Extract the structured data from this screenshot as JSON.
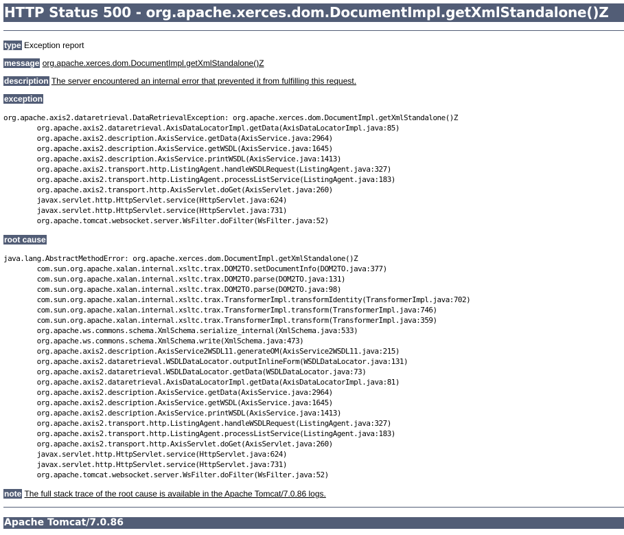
{
  "heading": "HTTP Status 500 - org.apache.xerces.dom.DocumentImpl.getXmlStandalone()Z",
  "type": {
    "label": "type",
    "value": "Exception report"
  },
  "message": {
    "label": "message",
    "value": "org.apache.xerces.dom.DocumentImpl.getXmlStandalone()Z"
  },
  "description": {
    "label": "description",
    "value": "The server encountered an internal error that prevented it from fulfilling this request."
  },
  "exception": {
    "label": "exception",
    "trace": "org.apache.axis2.dataretrieval.DataRetrievalException: org.apache.xerces.dom.DocumentImpl.getXmlStandalone()Z\n\torg.apache.axis2.dataretrieval.AxisDataLocatorImpl.getData(AxisDataLocatorImpl.java:85)\n\torg.apache.axis2.description.AxisService.getData(AxisService.java:2964)\n\torg.apache.axis2.description.AxisService.getWSDL(AxisService.java:1645)\n\torg.apache.axis2.description.AxisService.printWSDL(AxisService.java:1413)\n\torg.apache.axis2.transport.http.ListingAgent.handleWSDLRequest(ListingAgent.java:327)\n\torg.apache.axis2.transport.http.ListingAgent.processListService(ListingAgent.java:183)\n\torg.apache.axis2.transport.http.AxisServlet.doGet(AxisServlet.java:260)\n\tjavax.servlet.http.HttpServlet.service(HttpServlet.java:624)\n\tjavax.servlet.http.HttpServlet.service(HttpServlet.java:731)\n\torg.apache.tomcat.websocket.server.WsFilter.doFilter(WsFilter.java:52)"
  },
  "root_cause": {
    "label": "root cause",
    "trace": "java.lang.AbstractMethodError: org.apache.xerces.dom.DocumentImpl.getXmlStandalone()Z\n\tcom.sun.org.apache.xalan.internal.xsltc.trax.DOM2TO.setDocumentInfo(DOM2TO.java:377)\n\tcom.sun.org.apache.xalan.internal.xsltc.trax.DOM2TO.parse(DOM2TO.java:131)\n\tcom.sun.org.apache.xalan.internal.xsltc.trax.DOM2TO.parse(DOM2TO.java:98)\n\tcom.sun.org.apache.xalan.internal.xsltc.trax.TransformerImpl.transformIdentity(TransformerImpl.java:702)\n\tcom.sun.org.apache.xalan.internal.xsltc.trax.TransformerImpl.transform(TransformerImpl.java:746)\n\tcom.sun.org.apache.xalan.internal.xsltc.trax.TransformerImpl.transform(TransformerImpl.java:359)\n\torg.apache.ws.commons.schema.XmlSchema.serialize_internal(XmlSchema.java:533)\n\torg.apache.ws.commons.schema.XmlSchema.write(XmlSchema.java:473)\n\torg.apache.axis2.description.AxisService2WSDL11.generateOM(AxisService2WSDL11.java:215)\n\torg.apache.axis2.dataretrieval.WSDLDataLocator.outputInlineForm(WSDLDataLocator.java:131)\n\torg.apache.axis2.dataretrieval.WSDLDataLocator.getData(WSDLDataLocator.java:73)\n\torg.apache.axis2.dataretrieval.AxisDataLocatorImpl.getData(AxisDataLocatorImpl.java:81)\n\torg.apache.axis2.description.AxisService.getData(AxisService.java:2964)\n\torg.apache.axis2.description.AxisService.getWSDL(AxisService.java:1645)\n\torg.apache.axis2.description.AxisService.printWSDL(AxisService.java:1413)\n\torg.apache.axis2.transport.http.ListingAgent.handleWSDLRequest(ListingAgent.java:327)\n\torg.apache.axis2.transport.http.ListingAgent.processListService(ListingAgent.java:183)\n\torg.apache.axis2.transport.http.AxisServlet.doGet(AxisServlet.java:260)\n\tjavax.servlet.http.HttpServlet.service(HttpServlet.java:624)\n\tjavax.servlet.http.HttpServlet.service(HttpServlet.java:731)\n\torg.apache.tomcat.websocket.server.WsFilter.doFilter(WsFilter.java:52)"
  },
  "note": {
    "label": "note",
    "value": "The full stack trace of the root cause is available in the Apache Tomcat/7.0.86 logs."
  },
  "footer": "Apache Tomcat/7.0.86",
  "colors": {
    "header_bg": "#525d76",
    "header_fg": "#ffffff",
    "text": "#000000",
    "background": "#ffffff"
  }
}
